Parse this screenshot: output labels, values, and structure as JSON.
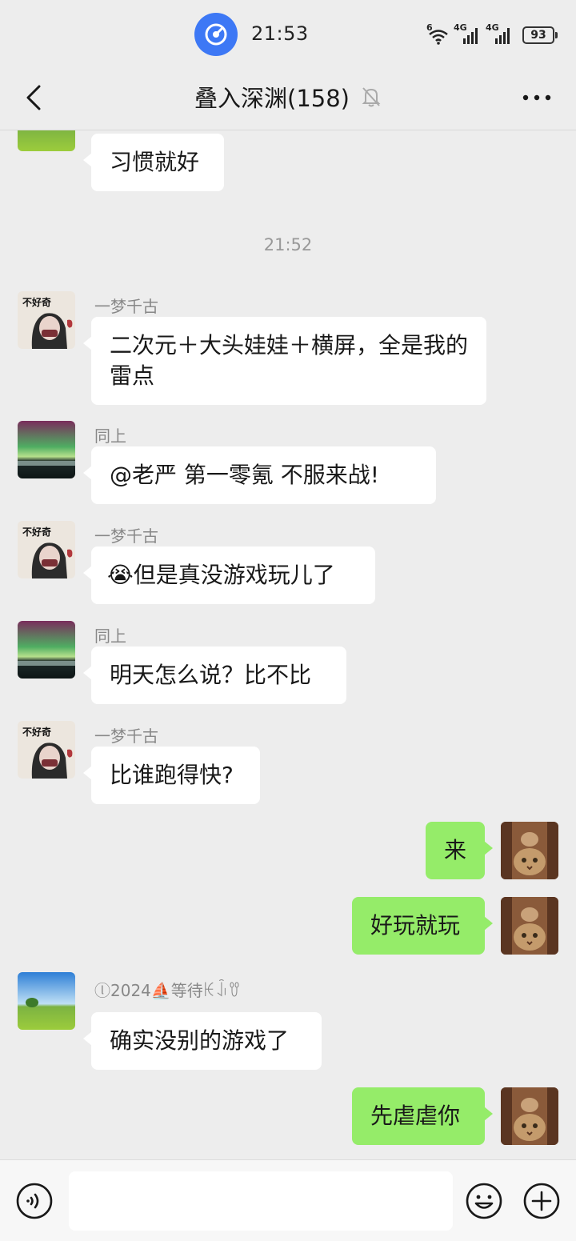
{
  "status_bar": {
    "time": "21:53",
    "wifi_label": "6",
    "signal1_label": "4G",
    "signal2_label": "4G",
    "battery": "93"
  },
  "nav": {
    "title": "叠入深渊(158)",
    "back_icon": "chevron-left-icon",
    "mute_icon": "bell-off-icon",
    "more_icon": "more-icon"
  },
  "messages": [
    {
      "type": "text",
      "side": "left",
      "sender": "",
      "text": "习惯就好"
    },
    {
      "type": "time",
      "text": "21:52"
    },
    {
      "type": "text",
      "side": "left",
      "sender": "一梦千古",
      "text": "二次元＋大头娃娃＋横屏，全是我的雷点"
    },
    {
      "type": "text",
      "side": "left",
      "sender": "同上",
      "text": "@老严 第一零氪 不服来战!"
    },
    {
      "type": "text",
      "side": "left",
      "sender": "一梦千古",
      "text": "但是真没游戏玩儿了",
      "emoji": "😭"
    },
    {
      "type": "text",
      "side": "left",
      "sender": "同上",
      "text": "明天怎么说？比不比"
    },
    {
      "type": "text",
      "side": "left",
      "sender": "一梦千古",
      "text": "比谁跑得快?"
    },
    {
      "type": "text",
      "side": "right",
      "text": "来"
    },
    {
      "type": "text",
      "side": "right",
      "text": "好玩就玩"
    },
    {
      "type": "text",
      "side": "left",
      "sender": "ⓛ2024⛵等待ꀘꀭꀎ",
      "text": "确实没别的游戏了"
    },
    {
      "type": "text",
      "side": "right",
      "text": "先虐虐你"
    }
  ],
  "avatar_labels": {
    "manga": "不好奇"
  },
  "input_bar": {
    "voice_icon": "voice-icon",
    "emoji_icon": "smile-icon",
    "plus_icon": "plus-circle-icon"
  },
  "colors": {
    "background": "#ededed",
    "my_bubble": "#95ec69",
    "their_bubble": "#ffffff",
    "app_icon": "#3d78f5"
  }
}
